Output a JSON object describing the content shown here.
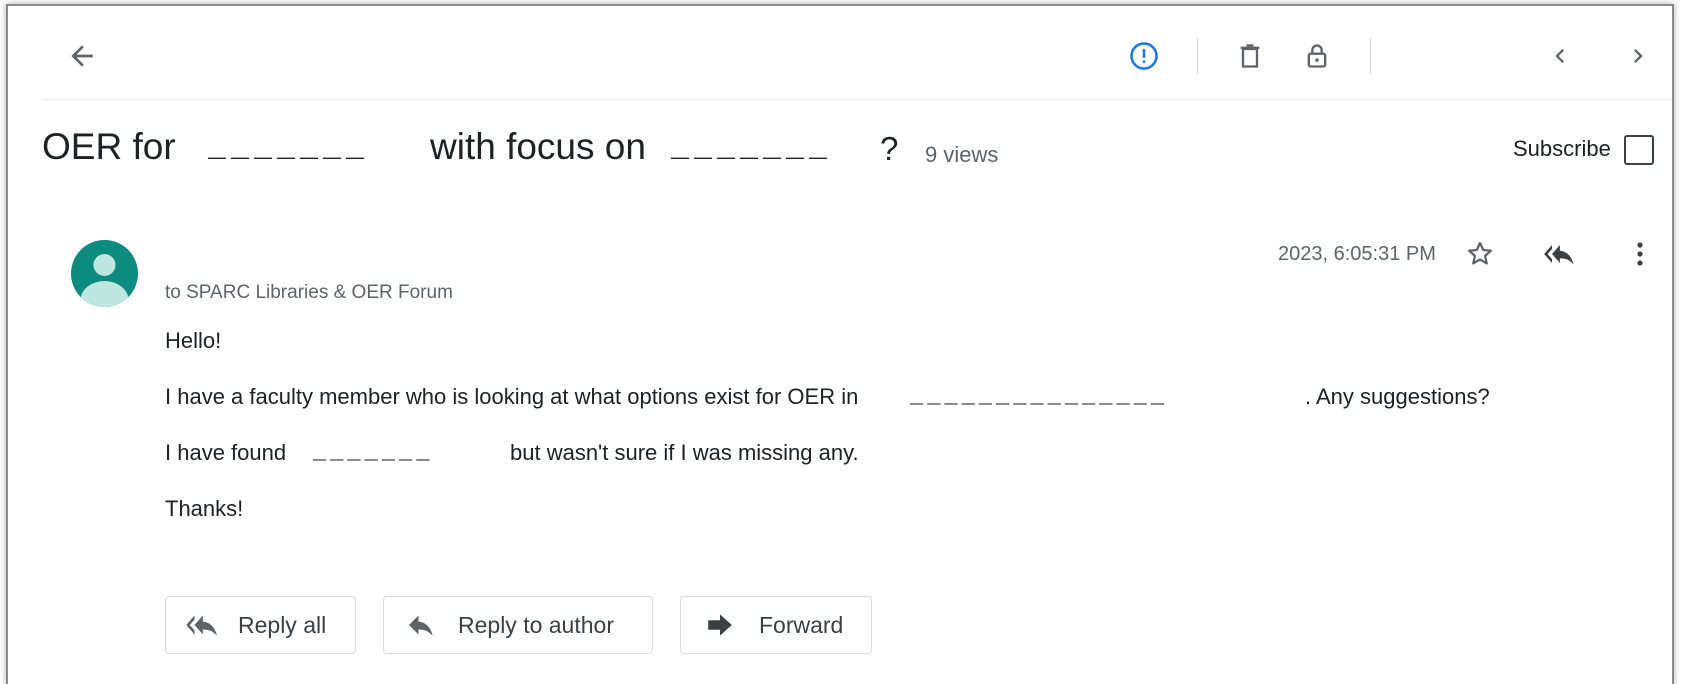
{
  "toolbar": {
    "back_icon": "arrow-left-icon",
    "report_icon": "report-spam-icon",
    "delete_icon": "trash-icon",
    "lock_icon": "lock-icon",
    "prev_icon": "chevron-left-icon",
    "next_icon": "chevron-right-icon",
    "accent_color": "#1a73e8"
  },
  "thread": {
    "title_part1": "OER for",
    "title_blank1": "_______",
    "title_part2": "with focus on",
    "title_blank2": "_______",
    "title_qmark": "?",
    "views": "9 views",
    "subscribe_label": "Subscribe",
    "subscribed": false
  },
  "message": {
    "avatar_color": "#0d8b7e",
    "date": "2023, 6:05:31 PM",
    "recipient": "to SPARC Libraries & OER Forum",
    "greeting": "Hello!",
    "line1_a": "I have a faculty member who is looking at what options exist for OER in",
    "line1_blank": "_______________",
    "line1_b": ". Any suggestions?",
    "line2_a": "I have found",
    "line2_blank": "_______",
    "line2_b": "but wasn't sure if I was missing any.",
    "signoff": "Thanks!"
  },
  "actions": {
    "reply_all": "Reply all",
    "reply_author": "Reply to author",
    "forward": "Forward"
  }
}
